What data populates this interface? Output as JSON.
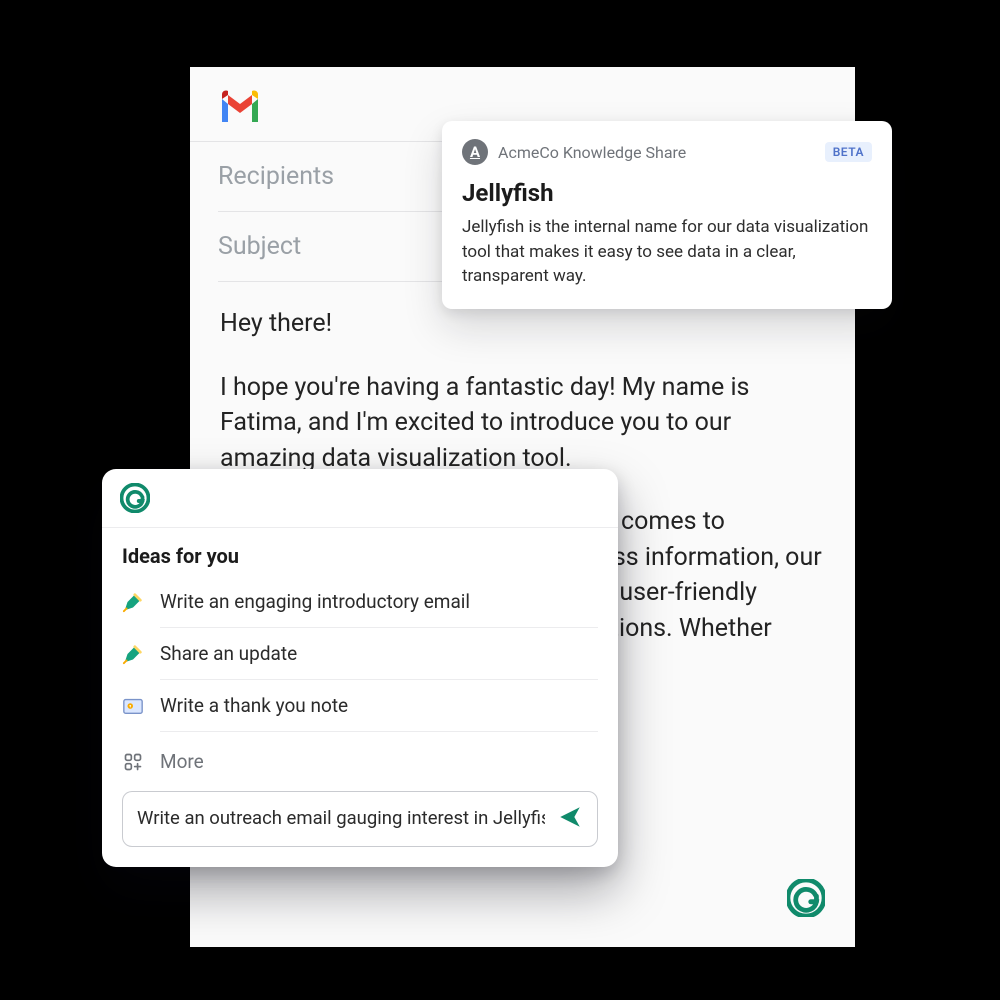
{
  "gmail": {
    "recipients_placeholder": "Recipients",
    "subject_placeholder": "Subject",
    "body_paragraphs": [
      "Hey there!",
      "I hope you're having a fantastic day! My name is Fatima, and I'm excited to introduce you to our amazing data visualization tool.",
      "I get it – charts and graphs. When it comes to understanding your valuable business information, our tool simplifies it and presents it in a user-friendly format, offering appealing visualizations. Whether you're ... it's the perfect choice."
    ]
  },
  "knowledge": {
    "avatar_letter": "A",
    "source": "AcmeCo Knowledge Share",
    "badge": "BETA",
    "title": "Jellyfish",
    "description": "Jellyfish is the internal name for our data visualization tool that makes it easy to see data in a clear, transparent way."
  },
  "ideas": {
    "heading": "Ideas for you",
    "items": [
      {
        "label": "Write an engaging introductory email",
        "icon": "pen"
      },
      {
        "label": "Share an update",
        "icon": "pen"
      },
      {
        "label": "Write a thank you note",
        "icon": "card"
      }
    ],
    "more_label": "More",
    "prompt_value": "Write an outreach email gauging interest in Jellyfish"
  },
  "colors": {
    "grammarly_green": "#108a6b"
  }
}
